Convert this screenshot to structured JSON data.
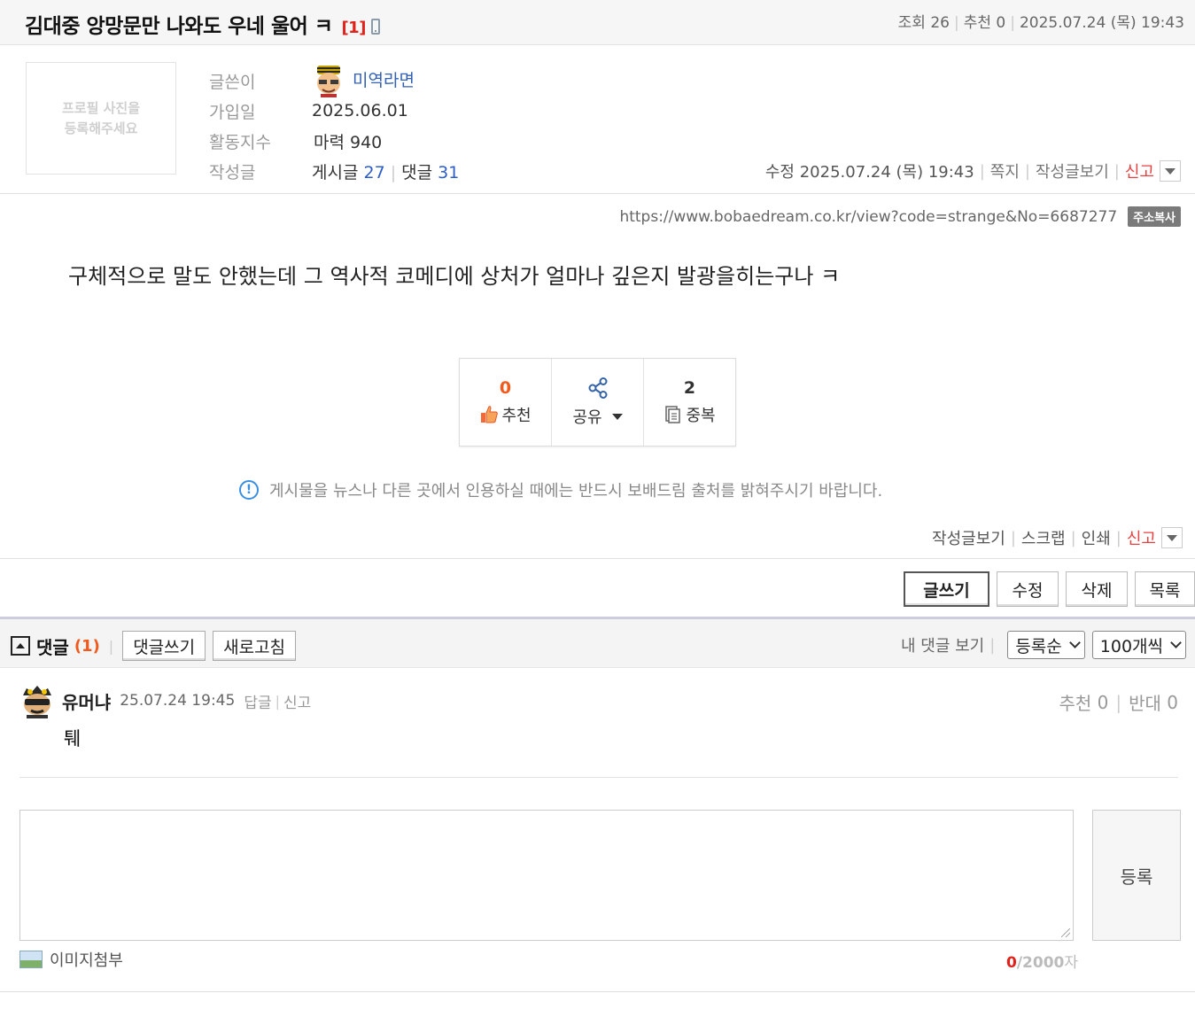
{
  "post": {
    "title": "김대중 앙망문만 나와도 우네 울어 ㅋ",
    "comment_badge": "[1]",
    "meta": {
      "views_label": "조회",
      "views": "26",
      "recommend_label": "추천",
      "recommend": "0",
      "datetime": "2025.07.24 (목) 19:43"
    },
    "profile": {
      "placeholder_line1": "프로필 사진을",
      "placeholder_line2": "등록해주세요",
      "author_label": "글쓴이",
      "author": "미역라면",
      "joined_label": "가입일",
      "joined": "2025.06.01",
      "activity_label": "활동지수",
      "activity": "마력 940",
      "posts_label": "작성글",
      "posts_text": "게시글",
      "posts_count": "27",
      "comments_text": "댓글",
      "comments_count": "31"
    },
    "edit_meta": {
      "edited": "수정 2025.07.24 (목) 19:43",
      "message": "쪽지",
      "view_posts": "작성글보기",
      "report": "신고"
    },
    "url": "https://www.bobaedream.co.kr/view?code=strange&No=6687277",
    "url_copy": "주소복사",
    "body": "구체적으로 말도 안했는데 그 역사적 코메디에 상처가 얼마나 깊은지 발광을히는구나 ㅋ",
    "reactions": {
      "recommend_count": "0",
      "recommend_label": "추천",
      "share_label": "공유",
      "duplicate_count": "2",
      "duplicate_label": "중복"
    },
    "notice": "게시물을 뉴스나 다른 곳에서 인용하실 때에는 반드시 보배드림 출처를 밝혀주시기 바랍니다.",
    "links": {
      "view_posts": "작성글보기",
      "scrap": "스크랩",
      "print": "인쇄",
      "report": "신고"
    },
    "actions": {
      "write": "글쓰기",
      "edit": "수정",
      "delete": "삭제",
      "list": "목록"
    }
  },
  "comments": {
    "title": "댓글",
    "count": "(1)",
    "write_btn": "댓글쓰기",
    "refresh_btn": "새로고침",
    "my_comments": "내 댓글 보기",
    "sort": "등록순",
    "per_page": "100개씩",
    "items": [
      {
        "name": "유머냐",
        "date": "25.07.24 19:45",
        "reply": "답글",
        "report": "신고",
        "up_label": "추천",
        "up": "0",
        "down_label": "반대",
        "down": "0",
        "text": "퉤"
      }
    ],
    "submit": "등록",
    "attach": "이미지첨부",
    "char_count": "0",
    "char_max": "/2000",
    "char_unit": "자"
  },
  "colors": {
    "accent_red": "#e0221c",
    "accent_orange": "#f05a1d",
    "link_blue": "#2d5ec8"
  }
}
